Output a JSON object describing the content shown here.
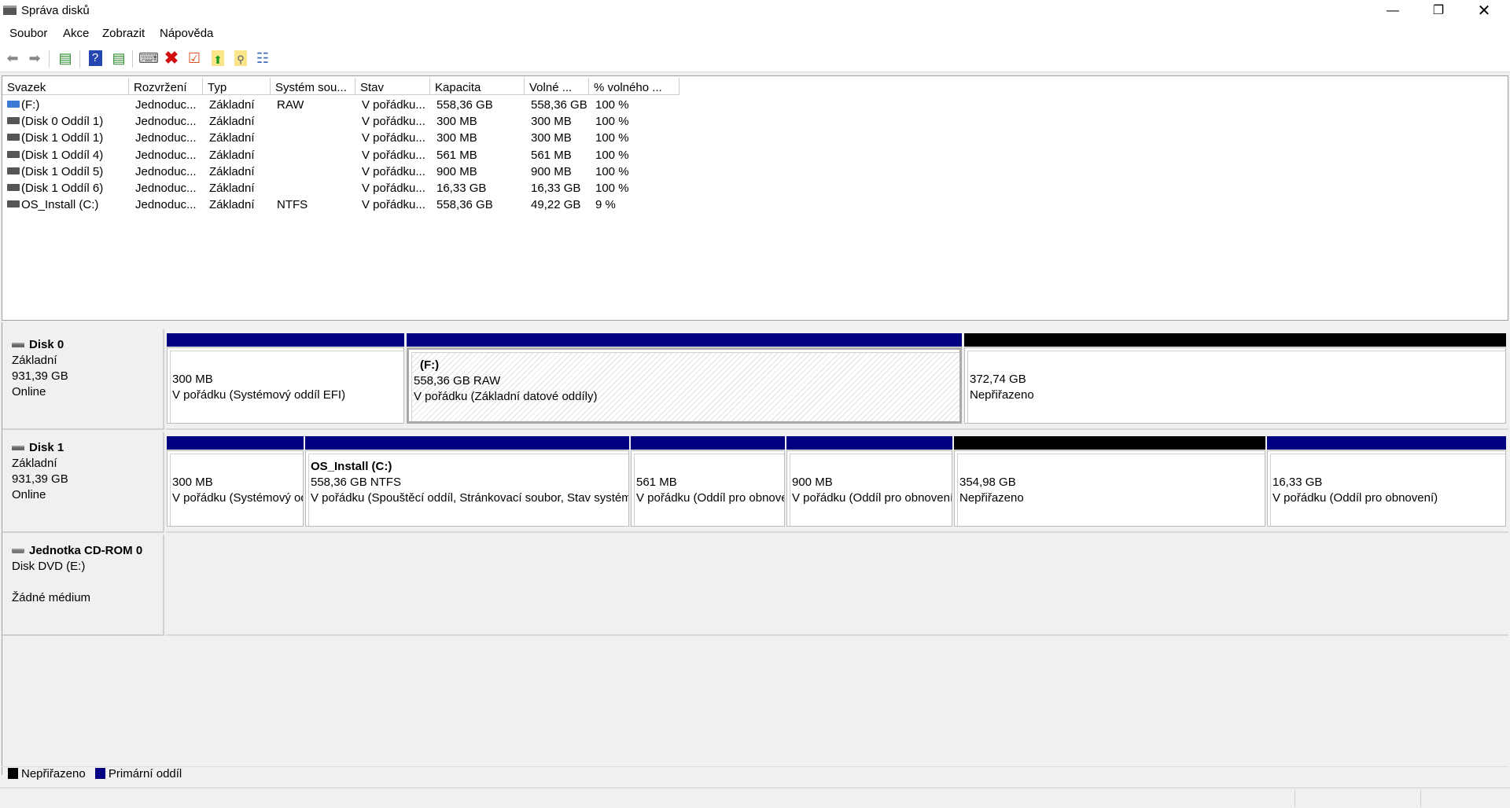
{
  "window": {
    "title": "Správa disků"
  },
  "menu": [
    "Soubor",
    "Akce",
    "Zobrazit",
    "Nápověda"
  ],
  "toolbar": [
    "back-icon",
    "forward-icon",
    "console-tree-icon",
    "help-icon",
    "action-pane-icon",
    "connect-disk-icon",
    "delete-icon",
    "check-icon",
    "folder-up-icon",
    "folder-search-icon",
    "properties-icon"
  ],
  "columns": [
    "Svazek",
    "Rozvržení",
    "Typ",
    "Systém sou...",
    "Stav",
    "Kapacita",
    "Volné ...",
    "% volného ..."
  ],
  "volumes": [
    [
      "(F:)",
      "Jednoduc...",
      "Základní",
      "RAW",
      "V pořádku...",
      "558,36 GB",
      "558,36 GB",
      "100 %"
    ],
    [
      "(Disk 0 Oddíl 1)",
      "Jednoduc...",
      "Základní",
      "",
      "V pořádku...",
      "300 MB",
      "300 MB",
      "100 %"
    ],
    [
      "(Disk 1 Oddíl 1)",
      "Jednoduc...",
      "Základní",
      "",
      "V pořádku...",
      "300 MB",
      "300 MB",
      "100 %"
    ],
    [
      "(Disk 1 Oddíl 4)",
      "Jednoduc...",
      "Základní",
      "",
      "V pořádku...",
      "561 MB",
      "561 MB",
      "100 %"
    ],
    [
      "(Disk 1 Oddíl 5)",
      "Jednoduc...",
      "Základní",
      "",
      "V pořádku...",
      "900 MB",
      "900 MB",
      "100 %"
    ],
    [
      "(Disk 1 Oddíl 6)",
      "Jednoduc...",
      "Základní",
      "",
      "V pořádku...",
      "16,33 GB",
      "16,33 GB",
      "100 %"
    ],
    [
      "OS_Install (C:)",
      "Jednoduc...",
      "Základní",
      "NTFS",
      "V pořádku...",
      "558,36 GB",
      "49,22 GB",
      "9 %"
    ]
  ],
  "disks": [
    {
      "name": "Disk 0",
      "type": "Základní",
      "size": "931,39 GB",
      "status": "Online",
      "partitions": [
        {
          "title": "",
          "size": "300 MB",
          "status": "V pořádku (Systémový oddíl EFI)",
          "kind": "primary"
        },
        {
          "title": "(F:)",
          "size": "558,36 GB RAW",
          "status": "V pořádku (Základní datové oddíly)",
          "kind": "primary",
          "selected": true
        },
        {
          "title": "",
          "size": "372,74 GB",
          "status": "Nepřiřazeno",
          "kind": "unallocated"
        }
      ]
    },
    {
      "name": "Disk 1",
      "type": "Základní",
      "size": "931,39 GB",
      "status": "Online",
      "partitions": [
        {
          "title": "",
          "size": "300 MB",
          "status": "V pořádku (Systémový oddíl EFI)",
          "kind": "primary"
        },
        {
          "title": "OS_Install  (C:)",
          "size": "558,36 GB NTFS",
          "status": "V pořádku (Spouštěcí oddíl, Stránkovací soubor, Stav systému, Primární oddíl)",
          "kind": "primary"
        },
        {
          "title": "",
          "size": "561 MB",
          "status": "V pořádku (Oddíl pro obnovení)",
          "kind": "primary"
        },
        {
          "title": "",
          "size": "900 MB",
          "status": "V pořádku (Oddíl pro obnovení)",
          "kind": "primary"
        },
        {
          "title": "",
          "size": "354,98 GB",
          "status": "Nepřiřazeno",
          "kind": "unallocated"
        },
        {
          "title": "",
          "size": "16,33 GB",
          "status": "V pořádku (Oddíl pro obnovení)",
          "kind": "primary"
        }
      ]
    }
  ],
  "cdrom": {
    "name": "Jednotka CD-ROM 0",
    "type": "Disk DVD (E:)",
    "status": "Žádné médium"
  },
  "legend": [
    {
      "label": "Nepřiřazeno",
      "color": "#000000"
    },
    {
      "label": "Primární oddíl",
      "color": "#000080"
    }
  ],
  "colors": {
    "primary": "#000080",
    "unallocated": "#000000"
  }
}
